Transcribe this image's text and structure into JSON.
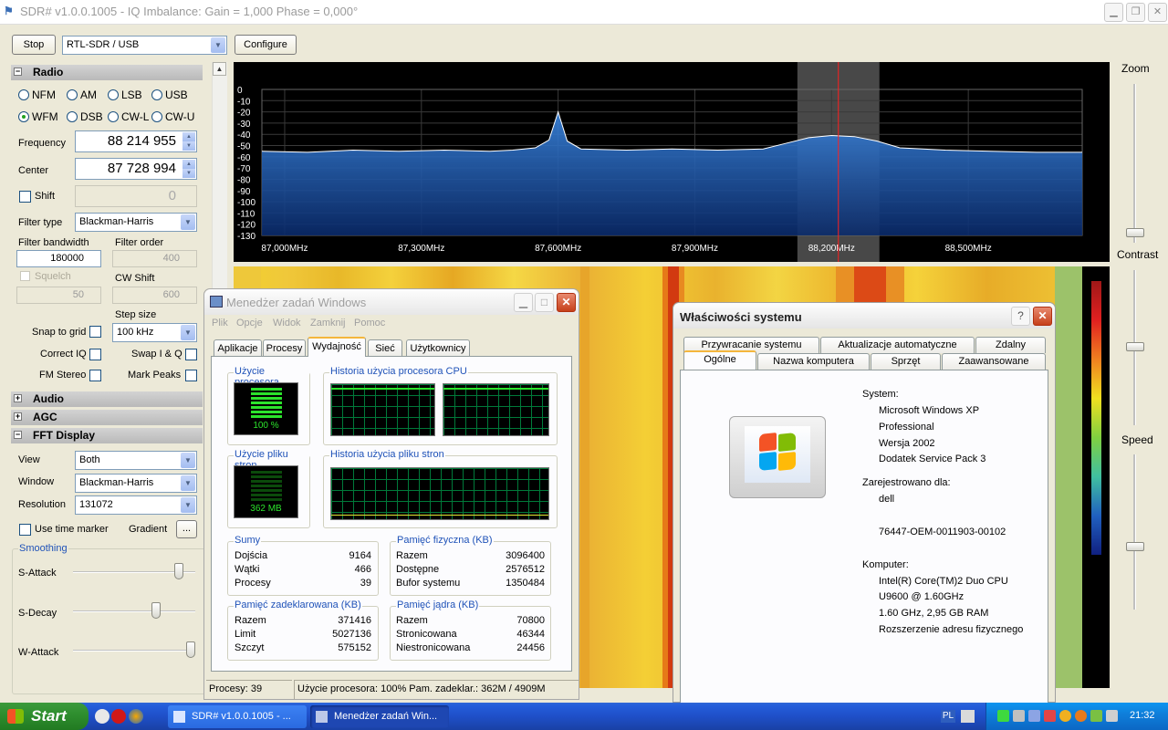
{
  "sdr": {
    "title": "SDR# v1.0.0.1005 - IQ Imbalance: Gain = 1,000 Phase = 0,000°",
    "stop_label": "Stop",
    "device": "RTL-SDR / USB",
    "configure_label": "Configure",
    "radio_section": "Radio",
    "modes": [
      "NFM",
      "AM",
      "LSB",
      "USB",
      "WFM",
      "DSB",
      "CW-L",
      "CW-U"
    ],
    "selected_mode": "WFM",
    "frequency_label": "Frequency",
    "frequency": "88 214 955",
    "center_label": "Center",
    "center": "87 728 994",
    "shift_label": "Shift",
    "shift": "0",
    "filter_type_label": "Filter type",
    "filter_type": "Blackman-Harris",
    "filter_bw_label": "Filter bandwidth",
    "filter_bw": "180000",
    "filter_order_label": "Filter order",
    "filter_order": "400",
    "squelch_label": "Squelch",
    "squelch": "50",
    "cw_shift_label": "CW Shift",
    "cw_shift": "600",
    "step_size_label": "Step size",
    "snap_label": "Snap to grid",
    "step_size": "100 kHz",
    "correct_iq_label": "Correct IQ",
    "swap_iq_label": "Swap I & Q",
    "fm_stereo_label": "FM Stereo",
    "mark_peaks_label": "Mark Peaks",
    "audio_section": "Audio",
    "agc_section": "AGC",
    "fft_section": "FFT Display",
    "view_label": "View",
    "view": "Both",
    "window_label": "Window",
    "window": "Blackman-Harris",
    "resolution_label": "Resolution",
    "resolution": "131072",
    "use_time_marker_label": "Use  time marker",
    "gradient_label": "Gradient",
    "gradient_btn": "...",
    "smoothing_label": "Smoothing",
    "s_attack_label": "S-Attack",
    "s_decay_label": "S-Decay",
    "w_attack_label": "W-Attack",
    "zoom_label": "Zoom",
    "contrast_label": "Contrast",
    "speed_label": "Speed",
    "plus_minus": "−",
    "plus": "+"
  },
  "chart_data": {
    "type": "line",
    "title": "",
    "xlabel": "",
    "ylabel": "",
    "y_ticks": [
      "0",
      "-10",
      "-20",
      "-30",
      "-40",
      "-50",
      "-60",
      "-70",
      "-80",
      "-90",
      "-100",
      "-110",
      "-120",
      "-130"
    ],
    "ylim": [
      -130,
      0
    ],
    "x_ticks": [
      "87,000MHz",
      "87,300MHz",
      "87,600MHz",
      "87,900MHz",
      "88,200MHz",
      "88,500MHz"
    ],
    "x_tick_values": [
      87.0,
      87.3,
      87.6,
      87.9,
      88.2,
      88.5
    ],
    "xlim": [
      86.95,
      88.75
    ],
    "x": [
      86.95,
      87.05,
      87.15,
      87.25,
      87.35,
      87.45,
      87.5,
      87.55,
      87.58,
      87.6,
      87.62,
      87.65,
      87.75,
      87.85,
      87.95,
      88.05,
      88.1,
      88.15,
      88.2,
      88.25,
      88.3,
      88.35,
      88.45,
      88.55,
      88.65,
      88.75
    ],
    "y": [
      -55,
      -56,
      -54,
      -55,
      -54,
      -55,
      -54,
      -52,
      -45,
      -20,
      -46,
      -53,
      -54,
      -53,
      -54,
      -53,
      -48,
      -43,
      -41,
      -42,
      -46,
      -52,
      -54,
      -55,
      -56,
      -56
    ],
    "marker_frequency": 88.214955,
    "filter_range": [
      88.125,
      88.305
    ],
    "grid": true
  },
  "taskman": {
    "title": "Menedżer zadań Windows",
    "menu": [
      "Plik",
      "Opcje",
      "Widok",
      "Zamknij",
      "Pomoc"
    ],
    "tabs": [
      "Aplikacje",
      "Procesy",
      "Wydajność",
      "Sieć",
      "Użytkownicy"
    ],
    "active_tab": "Wydajność",
    "cpu_usage_label": "Użycie procesora",
    "cpu_usage": "100 %",
    "cpu_history_label": "Historia użycia procesora CPU",
    "pf_usage_label": "Użycie pliku stron",
    "pf_usage": "362 MB",
    "pf_history_label": "Historia użycia pliku stron",
    "totals": {
      "title": "Sumy",
      "rows": [
        [
          "Dojścia",
          "9164"
        ],
        [
          "Wątki",
          "466"
        ],
        [
          "Procesy",
          "39"
        ]
      ]
    },
    "physical": {
      "title": "Pamięć fizyczna (KB)",
      "rows": [
        [
          "Razem",
          "3096400"
        ],
        [
          "Dostępne",
          "2576512"
        ],
        [
          "Bufor systemu",
          "1350484"
        ]
      ]
    },
    "commit": {
      "title": "Pamięć zadeklarowana (KB)",
      "rows": [
        [
          "Razem",
          "371416"
        ],
        [
          "Limit",
          "5027136"
        ],
        [
          "Szczyt",
          "575152"
        ]
      ]
    },
    "kernel": {
      "title": "Pamięć jądra (KB)",
      "rows": [
        [
          "Razem",
          "70800"
        ],
        [
          "Stronicowana",
          "46344"
        ],
        [
          "Niestronicowana",
          "24456"
        ]
      ]
    },
    "status_processes": "Procesy: 39",
    "status_cpu": "Użycie procesora: 100%",
    "status_commit": "Pam. zadeklar.: 362M / 4909M"
  },
  "sysprops": {
    "title": "Właściwości systemu",
    "tabs_row1": [
      "Przywracanie systemu",
      "Aktualizacje automatyczne",
      "Zdalny"
    ],
    "tabs_row2": [
      "Ogólne",
      "Nazwa komputera",
      "Sprzęt",
      "Zaawansowane"
    ],
    "active_tab": "Ogólne",
    "system_label": "System:",
    "system_lines": [
      "Microsoft Windows XP",
      "Professional",
      "Wersja 2002",
      "Dodatek Service Pack 3"
    ],
    "registered_label": "Zarejestrowano dla:",
    "registered_lines": [
      "dell",
      "",
      "76447-OEM-0011903-00102"
    ],
    "computer_label": "Komputer:",
    "computer_lines": [
      "Intel(R) Core(TM)2 Duo CPU",
      "U9600  @ 1.60GHz",
      "1.60 GHz, 2,95 GB RAM",
      "Rozszerzenie adresu fizycznego"
    ]
  },
  "taskbar": {
    "start_label": "Start",
    "items": [
      "SDR# v1.0.0.1005 - ...",
      "Menedżer zadań Win..."
    ],
    "lang": "PL",
    "clock": "21:32"
  },
  "colors": {
    "accent": "#1f52b8",
    "spectrum_fill": "#2a6cc8",
    "marker": "#ff2020",
    "xp_blue": "#245edb"
  }
}
